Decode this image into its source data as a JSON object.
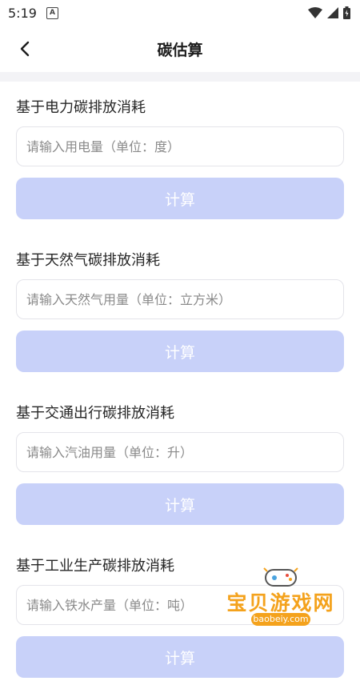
{
  "status_bar": {
    "time": "5:19",
    "notification_icon": "A"
  },
  "header": {
    "title": "碳估算",
    "back_icon": "chevron-left-icon"
  },
  "sections": [
    {
      "title": "基于电力碳排放消耗",
      "placeholder": "请输入用电量（单位：度）",
      "button": "计算"
    },
    {
      "title": "基于天然气碳排放消耗",
      "placeholder": "请输入天然气用量（单位：立方米）",
      "button": "计算"
    },
    {
      "title": "基于交通出行碳排放消耗",
      "placeholder": "请输入汽油用量（单位：升）",
      "button": "计算"
    },
    {
      "title": "基于工业生产碳排放消耗",
      "placeholder": "请输入铁水产量（单位：吨）",
      "button": "计算"
    }
  ],
  "watermark": {
    "name": "宝贝游戏网",
    "url": "baobeiy.com"
  },
  "colors": {
    "button_bg": "#c8d1f9",
    "divider": "#f3f3f6",
    "watermark": "#f4a21c"
  }
}
